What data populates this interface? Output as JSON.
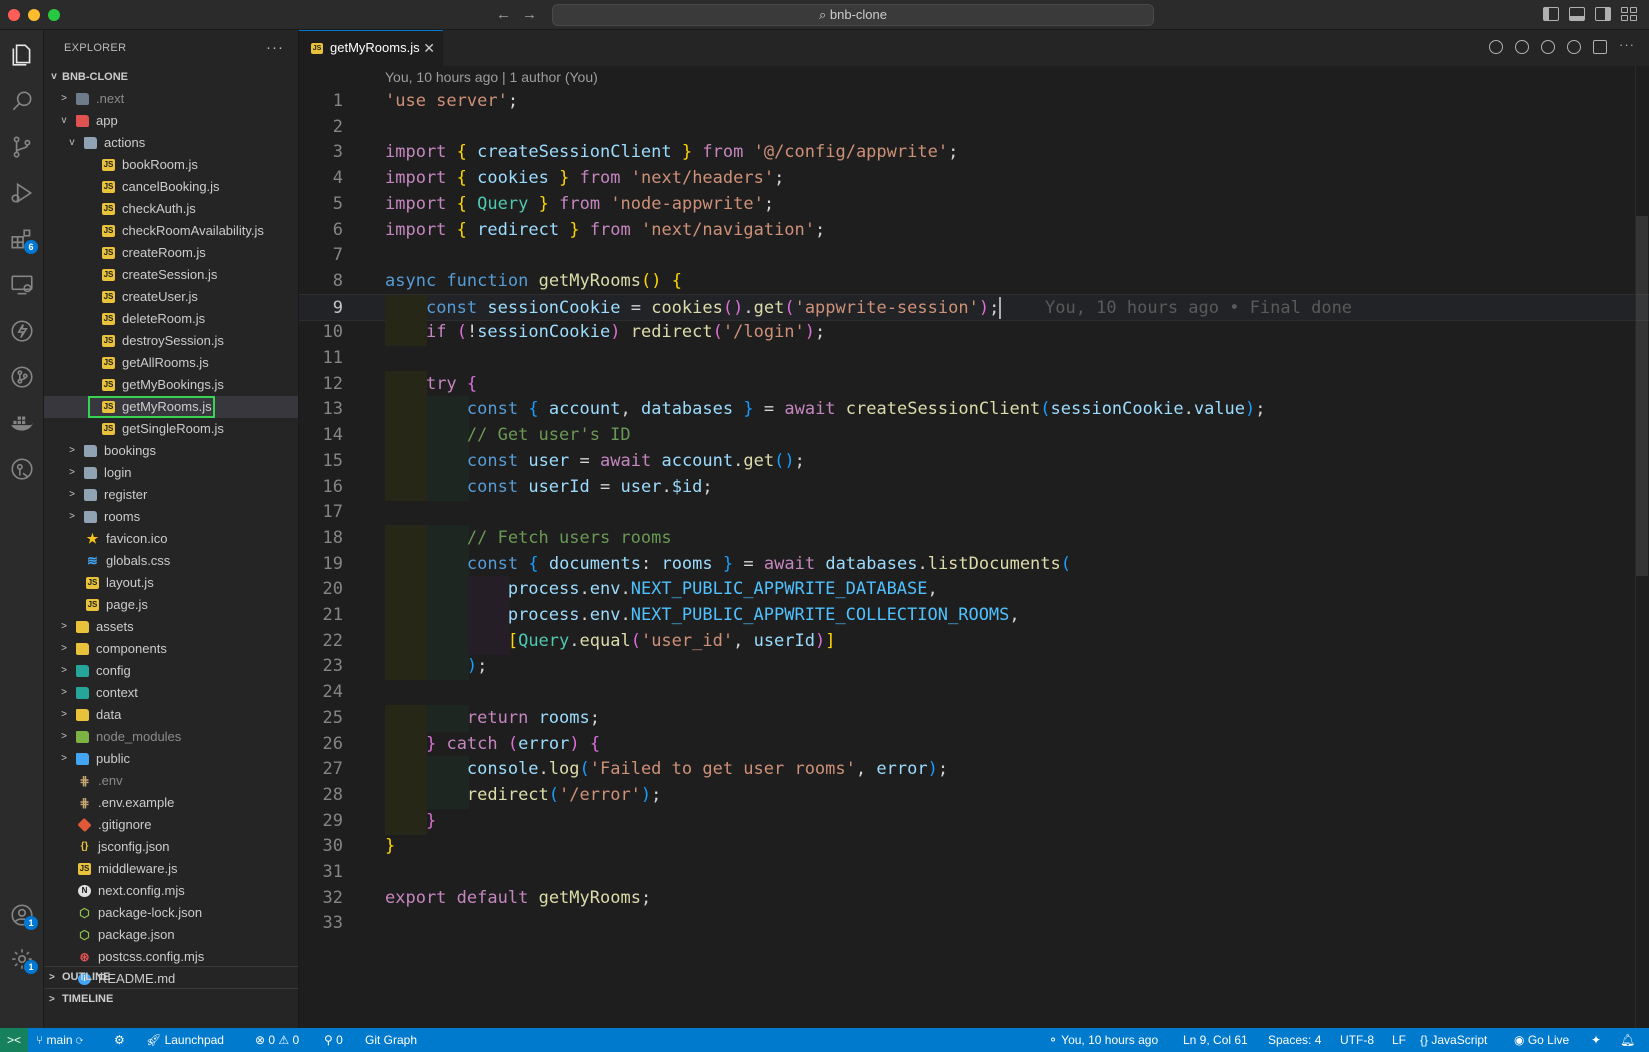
{
  "window": {
    "command_center": "bnb-clone"
  },
  "activity": {
    "extensions_badge": "6",
    "accounts_badge": "1",
    "manage_badge": "1"
  },
  "sidebar": {
    "title": "EXPLORER",
    "root": "BNB-CLONE",
    "tree": [
      {
        "label": ".next",
        "depth": 1,
        "kind": "folder",
        "icon": "f-next",
        "chev": ">",
        "dim": true
      },
      {
        "label": "app",
        "depth": 1,
        "kind": "folder",
        "icon": "f-app",
        "chev": "v"
      },
      {
        "label": "actions",
        "depth": 2,
        "kind": "folder",
        "icon": "folder",
        "chev": "v"
      },
      {
        "label": "bookRoom.js",
        "depth": 3,
        "icon": "js"
      },
      {
        "label": "cancelBooking.js",
        "depth": 3,
        "icon": "js"
      },
      {
        "label": "checkAuth.js",
        "depth": 3,
        "icon": "js"
      },
      {
        "label": "checkRoomAvailability.js",
        "depth": 3,
        "icon": "js"
      },
      {
        "label": "createRoom.js",
        "depth": 3,
        "icon": "js"
      },
      {
        "label": "createSession.js",
        "depth": 3,
        "icon": "js"
      },
      {
        "label": "createUser.js",
        "depth": 3,
        "icon": "js"
      },
      {
        "label": "deleteRoom.js",
        "depth": 3,
        "icon": "js"
      },
      {
        "label": "destroySession.js",
        "depth": 3,
        "icon": "js"
      },
      {
        "label": "getAllRooms.js",
        "depth": 3,
        "icon": "js"
      },
      {
        "label": "getMyBookings.js",
        "depth": 3,
        "icon": "js"
      },
      {
        "label": "getMyRooms.js",
        "depth": 3,
        "icon": "js",
        "selected": true
      },
      {
        "label": "getSingleRoom.js",
        "depth": 3,
        "icon": "js"
      },
      {
        "label": "bookings",
        "depth": 2,
        "kind": "folder",
        "icon": "folder",
        "chev": ">"
      },
      {
        "label": "login",
        "depth": 2,
        "kind": "folder",
        "icon": "folder",
        "chev": ">"
      },
      {
        "label": "register",
        "depth": 2,
        "kind": "folder",
        "icon": "folder",
        "chev": ">"
      },
      {
        "label": "rooms",
        "depth": 2,
        "kind": "folder",
        "icon": "folder",
        "chev": ">"
      },
      {
        "label": "favicon.ico",
        "depth": 2,
        "icon": "star"
      },
      {
        "label": "globals.css",
        "depth": 2,
        "icon": "css"
      },
      {
        "label": "layout.js",
        "depth": 2,
        "icon": "js"
      },
      {
        "label": "page.js",
        "depth": 2,
        "icon": "js"
      },
      {
        "label": "assets",
        "depth": 1,
        "kind": "folder",
        "icon": "f-yellow",
        "chev": ">"
      },
      {
        "label": "components",
        "depth": 1,
        "kind": "folder",
        "icon": "f-yellow",
        "chev": ">"
      },
      {
        "label": "config",
        "depth": 1,
        "kind": "folder",
        "icon": "f-teal",
        "chev": ">"
      },
      {
        "label": "context",
        "depth": 1,
        "kind": "folder",
        "icon": "f-teal",
        "chev": ">"
      },
      {
        "label": "data",
        "depth": 1,
        "kind": "folder",
        "icon": "f-yellow",
        "chev": ">"
      },
      {
        "label": "node_modules",
        "depth": 1,
        "kind": "folder",
        "icon": "f-green",
        "chev": ">",
        "dim": true
      },
      {
        "label": "public",
        "depth": 1,
        "kind": "folder",
        "icon": "f-blue",
        "chev": ">"
      },
      {
        "label": ".env",
        "depth": 1,
        "icon": "env",
        "dim": true
      },
      {
        "label": ".env.example",
        "depth": 1,
        "icon": "env"
      },
      {
        "label": ".gitignore",
        "depth": 1,
        "icon": "git"
      },
      {
        "label": "jsconfig.json",
        "depth": 1,
        "icon": "json"
      },
      {
        "label": "middleware.js",
        "depth": 1,
        "icon": "js"
      },
      {
        "label": "next.config.mjs",
        "depth": 1,
        "icon": "nextm"
      },
      {
        "label": "package-lock.json",
        "depth": 1,
        "icon": "node"
      },
      {
        "label": "package.json",
        "depth": 1,
        "icon": "node"
      },
      {
        "label": "postcss.config.mjs",
        "depth": 1,
        "icon": "post"
      },
      {
        "label": "README.md",
        "depth": 1,
        "icon": "info"
      }
    ],
    "outline": "OUTLINE",
    "timeline": "TIMELINE"
  },
  "editor": {
    "tab_label": "getMyRooms.js",
    "codelens": "You, 10 hours ago | 1 author (You)",
    "blame": "You, 10 hours ago • Final done",
    "current_line": 9,
    "lines": [
      "'use server';",
      "",
      "import { createSessionClient } from '@/config/appwrite';",
      "import { cookies } from 'next/headers';",
      "import { Query } from 'node-appwrite';",
      "import { redirect } from 'next/navigation';",
      "",
      "async function getMyRooms() {",
      "  const sessionCookie = cookies().get('appwrite-session');",
      "  if (!sessionCookie) redirect('/login');",
      "",
      "  try {",
      "    const { account, databases } = await createSessionClient(sessionCookie.value);",
      "    // Get user's ID",
      "    const user = await account.get();",
      "    const userId = user.$id;",
      "",
      "    // Fetch users rooms",
      "    const { documents: rooms } = await databases.listDocuments(",
      "      process.env.NEXT_PUBLIC_APPWRITE_DATABASE,",
      "      process.env.NEXT_PUBLIC_APPWRITE_COLLECTION_ROOMS,",
      "      [Query.equal('user_id', userId)]",
      "    );",
      "",
      "    return rooms;",
      "  } catch (error) {",
      "    console.log('Failed to get user rooms', error);",
      "    redirect('/error');",
      "  }",
      "}",
      "",
      "export default getMyRooms;",
      ""
    ]
  },
  "status": {
    "remote": "><",
    "branch": "main",
    "launchpad": "Launchpad",
    "problems": "⊗ 0 ⚠ 0",
    "ports": "0",
    "git_graph": "Git Graph",
    "blame": "You, 10 hours ago",
    "position": "Ln 9, Col 61",
    "spaces": "Spaces: 4",
    "encoding": "UTF-8",
    "eol": "LF",
    "language": "JavaScript",
    "golive": "Go Live"
  }
}
